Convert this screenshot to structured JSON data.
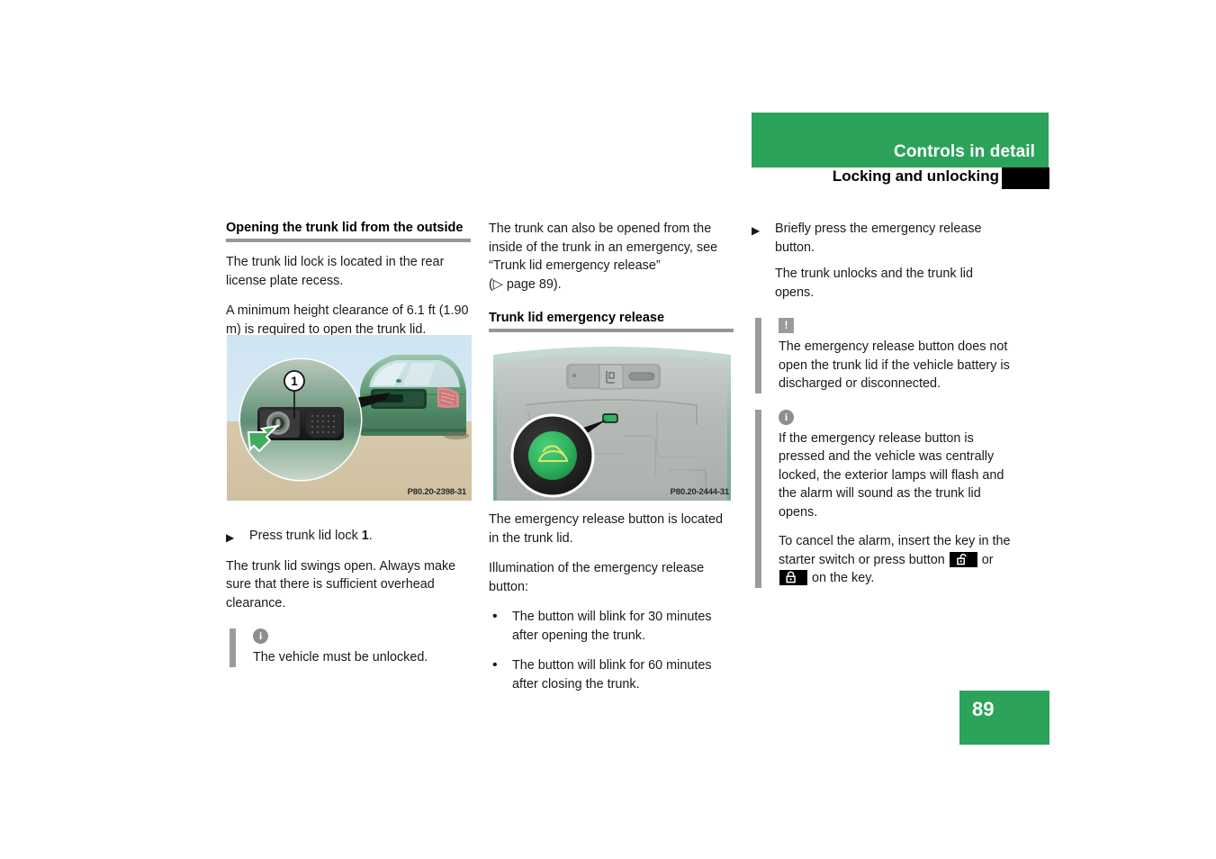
{
  "header": {
    "title": "Controls in detail",
    "subtitle": "Locking and unlocking",
    "green": "#2ba35a",
    "tab_color": "#000000"
  },
  "page_number": "89",
  "column1": {
    "section_heading": "Opening the trunk lid from the outside",
    "para1": "The trunk lid lock is located in the rear license plate recess.",
    "para2": "A minimum height clearance of 6.1 ft (1.90 m) is required to open the trunk lid.",
    "figure": {
      "name": "trunk-lid-lock-illustration",
      "code": "P80.20-2398-31",
      "callout": "1"
    },
    "step1_arrow": "▶",
    "step1_text": "Press trunk lid lock ",
    "step1_bold": "1",
    "step1_tail": ".",
    "para3": "The trunk lid swings open. Always make sure that there is sufficient overhead clearance.",
    "note": {
      "icon": "info-icon",
      "icon_glyph": "i",
      "text": "The vehicle must be unlocked."
    }
  },
  "column2": {
    "para1": "The trunk can also be opened from the inside of the trunk in an emergency, see “Trunk lid emergency release”",
    "para1_ref": "(▷ page 89).",
    "section_heading": "Trunk lid emergency release",
    "figure": {
      "name": "emergency-release-button-illustration",
      "code": "P80.20-2444-31"
    },
    "para2": "The emergency release button is located in the trunk lid.",
    "para3": "Illumination of the emergency release button:",
    "bullets": [
      "The button will blink for 30 minutes after opening the trunk.",
      "The button will blink for 60 minutes after closing the trunk."
    ]
  },
  "column3": {
    "step1_arrow": "▶",
    "step1_text": "Briefly press the emergency release button.",
    "step1_sub": "The trunk unlocks and the trunk lid opens.",
    "warning_note": {
      "icon": "warning-icon",
      "icon_glyph": "!",
      "text": "The emergency release button does not open the trunk lid if the vehicle battery is discharged or disconnected."
    },
    "info_note": {
      "icon": "info-icon",
      "icon_glyph": "i",
      "para1": "If the emergency release button is pressed and the vehicle was centrally locked, the exterior lamps will flash and the alarm will sound as the trunk lid opens.",
      "para2_a": "To cancel the alarm, insert the key in the starter switch or press button ",
      "para2_b": " or ",
      "para2_c": " on the key.",
      "icon_unlock": "unlock-icon",
      "icon_lock": "lock-icon"
    }
  }
}
